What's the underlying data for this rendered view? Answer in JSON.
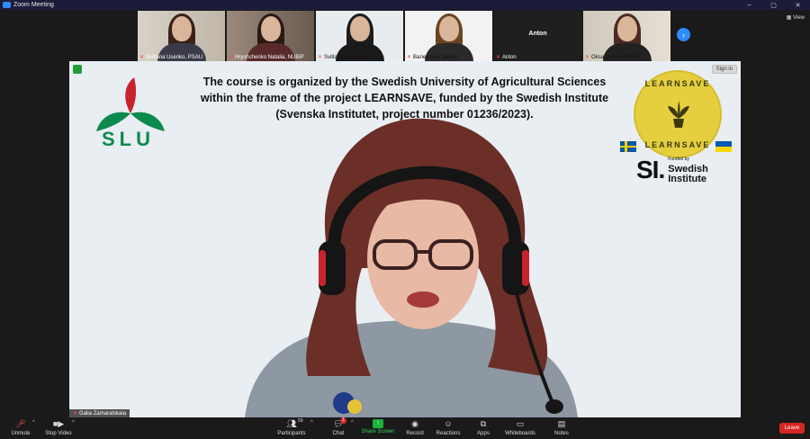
{
  "window": {
    "title": "Zoom Meeting",
    "controls": [
      "–",
      "▢",
      "✕"
    ]
  },
  "gallery": {
    "participants": [
      {
        "name": "Svitlana Usenko, PSAU",
        "muted": true
      },
      {
        "name": "Hryshchenko Natalia, NUBiP",
        "muted": true
      },
      {
        "name": "Svitlana Bazyvoliak",
        "muted": true
      },
      {
        "name": "Валентина Демко",
        "muted": true
      },
      {
        "name": "Anton",
        "muted": true,
        "display_name": "Anton"
      },
      {
        "name": "Oksana Kravchenko",
        "muted": true
      }
    ],
    "view_label": "View"
  },
  "main": {
    "sign_in_label": "Sign in",
    "slu_text": "SLU",
    "banner_text": "The course is organized by the Swedish University of Agricultural Sciences within the frame of the project LEARNSAVE, funded by the Swedish Institute (Svenska Institutet, project number 01236/2023).",
    "learnsave_top": "LEARNSAVE",
    "learnsave_bottom": "LEARNSAVE",
    "si_mark": "SI.",
    "si_funded": "Funded by",
    "si_name_1": "Swedish",
    "si_name_2": "Institute",
    "speaker_name": "Galia Zamaratskaia"
  },
  "toolbar": {
    "unmute": "Unmute",
    "stop_video": "Stop Video",
    "participants": "Participants",
    "participants_count": "59",
    "chat": "Chat",
    "chat_badge": "1",
    "share_screen": "Share Screen",
    "record": "Record",
    "reactions": "Reactions",
    "apps": "Apps",
    "whiteboards": "Whiteboards",
    "notes": "Notes",
    "leave": "Leave"
  }
}
